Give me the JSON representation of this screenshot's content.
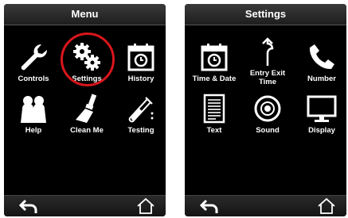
{
  "menu_screen": {
    "title": "Menu",
    "items": [
      {
        "label": "Controls",
        "icon": "wrench-icon"
      },
      {
        "label": "Settings",
        "icon": "gears-icon"
      },
      {
        "label": "History",
        "icon": "calendar-history-icon"
      },
      {
        "label": "Help",
        "icon": "people-icon"
      },
      {
        "label": "Clean Me",
        "icon": "brush-icon"
      },
      {
        "label": "Testing",
        "icon": "test-tube-icon"
      }
    ],
    "highlighted_item": "Settings",
    "highlight_color": "#d9161c"
  },
  "settings_screen": {
    "title": "Settings",
    "items": [
      {
        "label": "Time & Date",
        "icon": "calendar-clock-icon"
      },
      {
        "label": "Entry Exit Time",
        "icon": "entry-exit-icon"
      },
      {
        "label": "Number",
        "icon": "phone-icon"
      },
      {
        "label": "Text",
        "icon": "document-icon"
      },
      {
        "label": "Sound",
        "icon": "sound-icon"
      },
      {
        "label": "Display",
        "icon": "monitor-icon"
      }
    ]
  },
  "nav": {
    "back_icon": "back-arrow-icon",
    "home_icon": "home-icon"
  }
}
